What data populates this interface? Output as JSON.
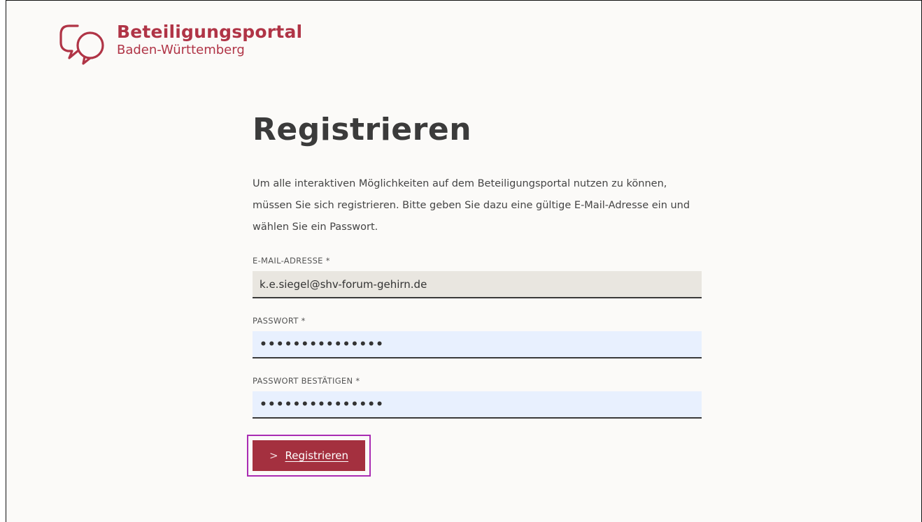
{
  "brand": {
    "title": "Beteiligungsportal",
    "subtitle": "Baden-Württemberg",
    "icon": "speech-bubbles-icon",
    "color": "#b03446"
  },
  "page": {
    "title": "Registrieren",
    "intro": "Um alle interaktiven Möglichkeiten auf dem Beteiligungsportal nutzen zu können, müssen Sie sich registrieren. Bitte geben Sie dazu eine gültige E-Mail-Adresse ein und wählen Sie ein Passwort."
  },
  "form": {
    "email": {
      "label": "E-MAIL-ADRESSE *",
      "value": "k.e.siegel@shv-forum-gehirn.de"
    },
    "password": {
      "label": "PASSWORT *",
      "value": "•••••••••••••••"
    },
    "password_confirm": {
      "label": "PASSWORT BESTÄTIGEN *",
      "value": "•••••••••••••••"
    },
    "submit": {
      "label": "Registrieren",
      "icon": "chevron-right-icon",
      "color": "#a4303f"
    }
  }
}
